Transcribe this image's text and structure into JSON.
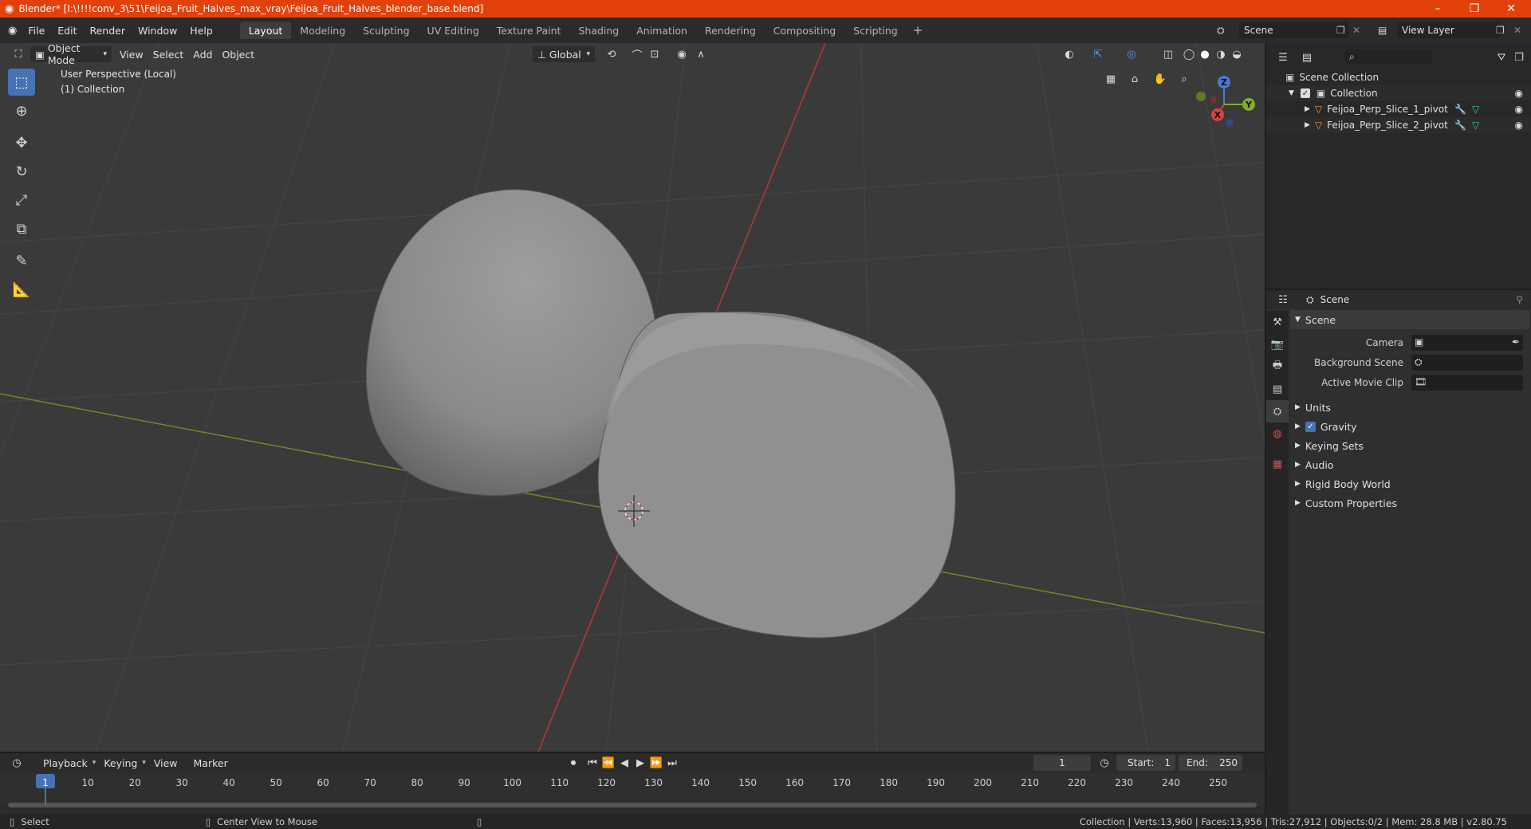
{
  "window": {
    "title": "Blender* [I:\\!!!!conv_3\\51\\Feijoa_Fruit_Halves_max_vray\\Feijoa_Fruit_Halves_blender_base.blend]",
    "minimize": "–",
    "maximize": "❐",
    "close": "✕"
  },
  "menu": [
    "File",
    "Edit",
    "Render",
    "Window",
    "Help"
  ],
  "workspaces": [
    "Layout",
    "Modeling",
    "Sculpting",
    "UV Editing",
    "Texture Paint",
    "Shading",
    "Animation",
    "Rendering",
    "Compositing",
    "Scripting"
  ],
  "scene_field": "Scene",
  "view_layer_field": "View Layer",
  "viewport": {
    "mode": "Object Mode",
    "menus": [
      "View",
      "Select",
      "Add",
      "Object"
    ],
    "transform": "Global",
    "info_line1": "User Perspective (Local)",
    "info_line2": "(1) Collection",
    "gizmo": {
      "x": "X",
      "y": "Y",
      "z": "Z"
    }
  },
  "outliner": {
    "root": "Scene Collection",
    "collection": "Collection",
    "objects": [
      "Feijoa_Perp_Slice_1_pivot",
      "Feijoa_Perp_Slice_2_pivot"
    ]
  },
  "properties": {
    "context": "Scene",
    "panel": "Scene",
    "camera_label": "Camera",
    "bg_scene_label": "Background Scene",
    "movie_clip_label": "Active Movie Clip",
    "subpanels": [
      "Units",
      "Gravity",
      "Keying Sets",
      "Audio",
      "Rigid Body World",
      "Custom Properties"
    ],
    "gravity_checked": true
  },
  "timeline": {
    "menus": [
      "Playback",
      "Keying",
      "View",
      "Marker"
    ],
    "current_frame": "1",
    "start_label": "Start:",
    "start": "1",
    "end_label": "End:",
    "end": "250",
    "ticks": [
      "1",
      "10",
      "20",
      "30",
      "40",
      "50",
      "60",
      "70",
      "80",
      "90",
      "100",
      "110",
      "120",
      "130",
      "140",
      "150",
      "160",
      "170",
      "180",
      "190",
      "200",
      "210",
      "220",
      "230",
      "240",
      "250"
    ]
  },
  "status": {
    "left": "Select",
    "middle": "Center View to Mouse",
    "right": "Collection | Verts:13,960 | Faces:13,956 | Tris:27,912 | Objects:0/2 | Mem: 28.8 MB | v2.80.75"
  }
}
